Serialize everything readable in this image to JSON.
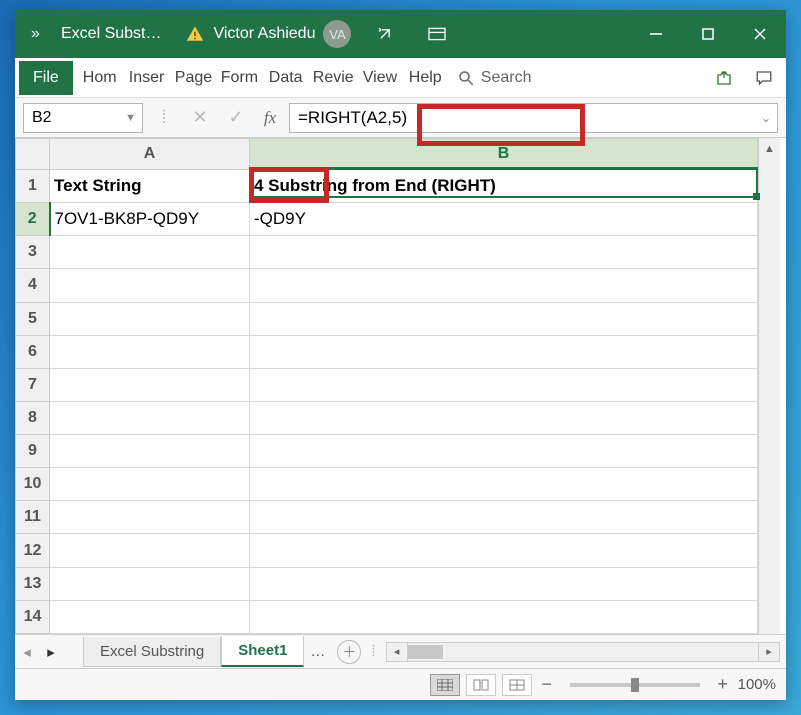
{
  "titlebar": {
    "doc_title": "Excel Subst…",
    "user_name": "Victor Ashiedu",
    "user_initials": "VA"
  },
  "menu": {
    "file": "File",
    "items": [
      "Hom",
      "Inser",
      "Page",
      "Form",
      "Data",
      "Revie",
      "View",
      "Help"
    ],
    "search": "Search"
  },
  "formula_bar": {
    "cell_ref": "B2",
    "fx": "fx",
    "formula": "=RIGHT(A2,5)"
  },
  "grid": {
    "col_headers": [
      "A",
      "B"
    ],
    "row_count": 14,
    "selected_cell": "B2",
    "cells": {
      "A1": "Text String",
      "B1": "4 Substring from End (RIGHT)",
      "A2": "7OV1-BK8P-QD9Y",
      "B2": "-QD9Y"
    }
  },
  "sheets": {
    "tabs": [
      "Excel Substring",
      "Sheet1"
    ],
    "active": 1,
    "ellipsis": "…"
  },
  "status": {
    "zoom": "100%"
  },
  "chart_data": null
}
